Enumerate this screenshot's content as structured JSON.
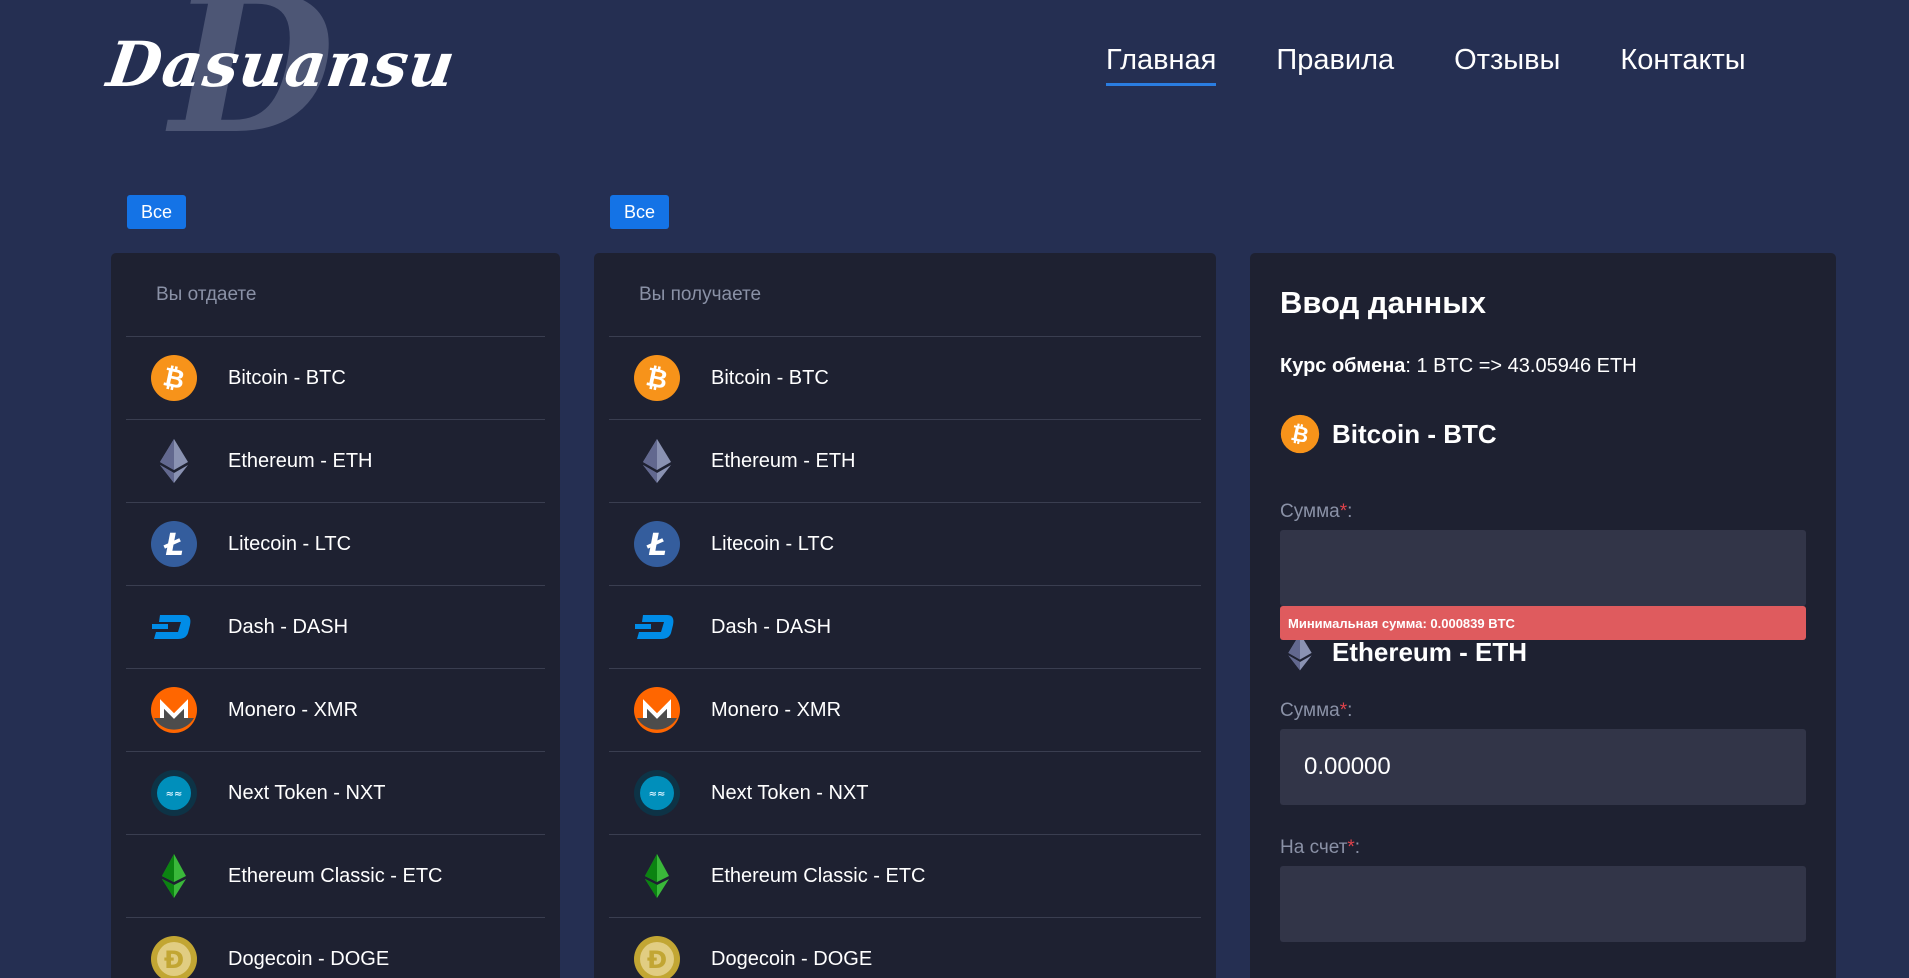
{
  "logo": {
    "text": "Dasuansu",
    "mark": "D"
  },
  "nav": {
    "home": "Главная",
    "rules": "Правила",
    "reviews": "Отзывы",
    "contacts": "Контакты"
  },
  "filters": {
    "left": "Все",
    "right": "Все"
  },
  "give": {
    "heading": "Вы отдаете",
    "coins": [
      {
        "label": "Bitcoin - BTC",
        "icon": "bitcoin-icon"
      },
      {
        "label": "Ethereum - ETH",
        "icon": "ethereum-icon"
      },
      {
        "label": "Litecoin - LTC",
        "icon": "litecoin-icon"
      },
      {
        "label": "Dash - DASH",
        "icon": "dash-icon"
      },
      {
        "label": "Monero - XMR",
        "icon": "monero-icon"
      },
      {
        "label": "Next Token - NXT",
        "icon": "nxt-icon"
      },
      {
        "label": "Ethereum Classic - ETC",
        "icon": "ethereum-classic-icon"
      },
      {
        "label": "Dogecoin - DOGE",
        "icon": "dogecoin-icon"
      }
    ]
  },
  "receive": {
    "heading": "Вы получаете",
    "coins": [
      {
        "label": "Bitcoin - BTC",
        "icon": "bitcoin-icon"
      },
      {
        "label": "Ethereum - ETH",
        "icon": "ethereum-icon"
      },
      {
        "label": "Litecoin - LTC",
        "icon": "litecoin-icon"
      },
      {
        "label": "Dash - DASH",
        "icon": "dash-icon"
      },
      {
        "label": "Monero - XMR",
        "icon": "monero-icon"
      },
      {
        "label": "Next Token - NXT",
        "icon": "nxt-icon"
      },
      {
        "label": "Ethereum Classic - ETC",
        "icon": "ethereum-classic-icon"
      },
      {
        "label": "Dogecoin - DOGE",
        "icon": "dogecoin-icon"
      }
    ]
  },
  "form": {
    "title": "Ввод данных",
    "rate_label": "Курс обмена",
    "rate_value": ": 1 BTC => 43.05946 ETH",
    "from_coin": "Bitcoin - BTC",
    "to_coin": "Ethereum - ETH",
    "amount_label": "Сумма",
    "required_mark": "*",
    "colon": ":",
    "from_amount_value": "",
    "min_error": "Минимальная сумма: 0.000839 BTC",
    "to_amount_value": "0.00000",
    "account_label": "На счет",
    "account_value": ""
  },
  "colors": {
    "background": "#252f52",
    "panel": "#1e2131",
    "accent": "#1473e6",
    "error": "#df5b5e",
    "input": "#323548"
  }
}
